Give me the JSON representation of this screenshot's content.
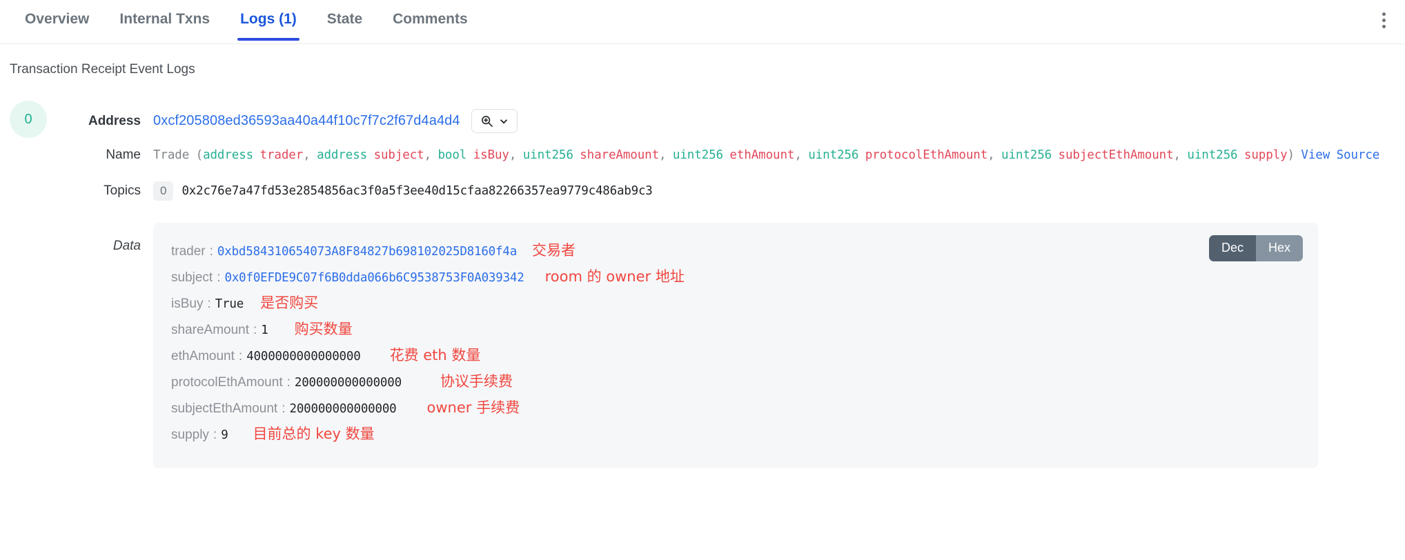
{
  "tabs": [
    {
      "label": "Overview",
      "active": false
    },
    {
      "label": "Internal Txns",
      "active": false
    },
    {
      "label": "Logs (1)",
      "active": true
    },
    {
      "label": "State",
      "active": false
    },
    {
      "label": "Comments",
      "active": false
    }
  ],
  "header": {
    "menu_icon": "kebab-vertical-icon"
  },
  "section": {
    "title": "Transaction Receipt Event Logs"
  },
  "log": {
    "index": "0",
    "address": {
      "label": "Address",
      "value": "0xcf205808ed36593aa40a44f10c7f7c2f67d4a4d4",
      "lookup_icon": "search-plus-icon",
      "chevron_icon": "chevron-down-icon"
    },
    "name": {
      "label": "Name",
      "event": "Trade",
      "params": [
        {
          "type": "address",
          "arg": "trader"
        },
        {
          "type": "address",
          "arg": "subject"
        },
        {
          "type": "bool",
          "arg": "isBuy"
        },
        {
          "type": "uint256",
          "arg": "shareAmount"
        },
        {
          "type": "uint256",
          "arg": "ethAmount"
        },
        {
          "type": "uint256",
          "arg": "protocolEthAmount"
        },
        {
          "type": "uint256",
          "arg": "subjectEthAmount"
        },
        {
          "type": "uint256",
          "arg": "supply"
        }
      ],
      "view_source": "View Source"
    },
    "topics": {
      "label": "Topics",
      "items": [
        {
          "index": "0",
          "value": "0x2c76e7a47fd53e2854856ac3f0a5f3ee40d15cfaa82266357ea9779c486ab9c3"
        }
      ]
    },
    "data": {
      "label": "Data",
      "toggle": {
        "dec": "Dec",
        "hex": "Hex",
        "active": "Dec"
      },
      "fields": [
        {
          "key": "trader",
          "value": "0xbd584310654073A8F84827b698102025D8160f4a",
          "link": true,
          "note": "交易者"
        },
        {
          "key": "subject",
          "value": "0x0f0EFDE9C07f6B0dda066b6C9538753F0A039342",
          "link": true,
          "note": "room 的 owner 地址"
        },
        {
          "key": "isBuy",
          "value": "True",
          "link": false,
          "note": "是否购买"
        },
        {
          "key": "shareAmount",
          "value": "1",
          "link": false,
          "note": "购买数量"
        },
        {
          "key": "ethAmount",
          "value": "4000000000000000",
          "link": false,
          "note": "花费 eth 数量"
        },
        {
          "key": "protocolEthAmount",
          "value": "200000000000000",
          "link": false,
          "note": "协议手续费"
        },
        {
          "key": "subjectEthAmount",
          "value": "200000000000000",
          "link": false,
          "note": "owner 手续费"
        },
        {
          "key": "supply",
          "value": "9",
          "link": false,
          "note": "目前总的 key 数量"
        }
      ]
    }
  },
  "colors": {
    "accent_blue": "#2c6ee8",
    "tab_active": "#1a56db",
    "type_teal": "#27b093",
    "arg_red": "#e1485a",
    "note_red": "#f0473f",
    "badge_teal": "#21b191",
    "badge_bg": "#e6f7f2",
    "panel_bg": "#f6f7f9",
    "toggle_on": "#53616f",
    "toggle_off": "#8694a1"
  }
}
